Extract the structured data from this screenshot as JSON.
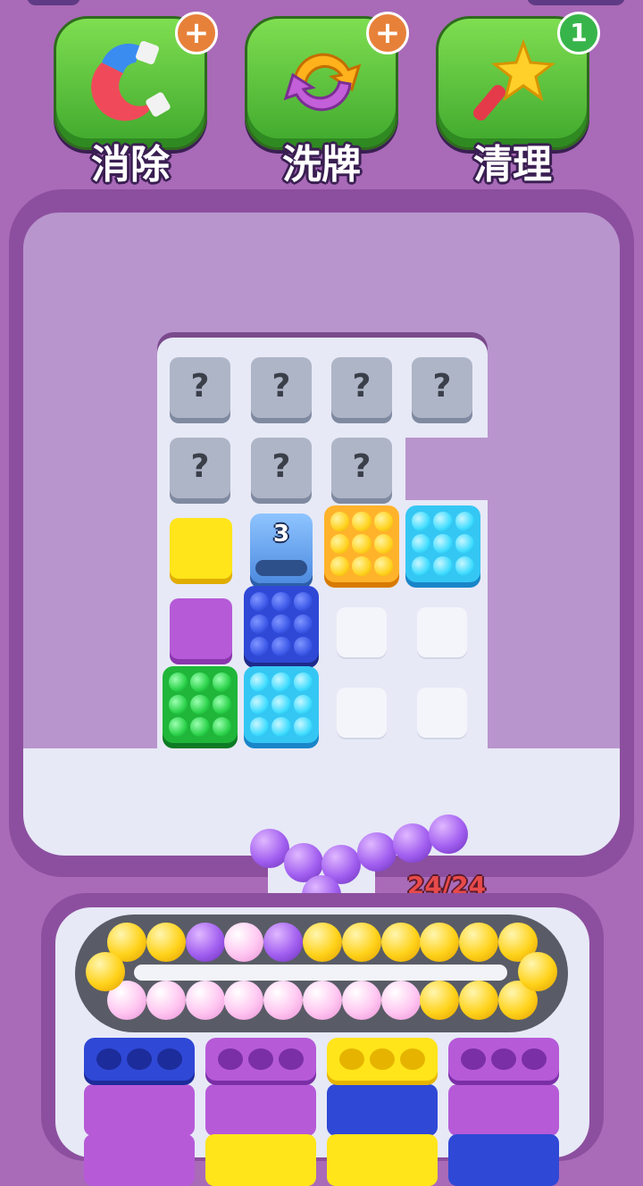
{
  "boosters": [
    {
      "label": "消除",
      "badge": "+",
      "icon": "magnet-icon"
    },
    {
      "label": "洗牌",
      "badge": "+",
      "icon": "shuffle-icon"
    },
    {
      "label": "清理",
      "badge": "1",
      "icon": "magic-wand-icon"
    }
  ],
  "board": {
    "unknown_symbol": "?",
    "counter_value": "3"
  },
  "capacity_text": "24/24",
  "colors": {
    "background": "#a96ab8",
    "board": "#b895cd",
    "floor": "#e7e9f6",
    "booster_green": "#4fbf36",
    "ball_purple": "#a25ff0",
    "ball_yellow": "#ffd21a",
    "ball_pink": "#ffc6f1"
  },
  "conveyor_balls": {
    "top_row": [
      "yellow",
      "yellow",
      "purple",
      "pink",
      "purple",
      "yellow",
      "yellow",
      "yellow",
      "yellow",
      "yellow",
      "yellow"
    ],
    "bottom_row": [
      "pink",
      "pink",
      "pink",
      "pink",
      "pink",
      "pink",
      "pink",
      "pink",
      "yellow",
      "yellow",
      "yellow"
    ],
    "left_end": "yellow",
    "right_end": "yellow"
  },
  "bins": [
    {
      "top": "blue",
      "layers": [
        "purple",
        "purple"
      ]
    },
    {
      "top": "purple",
      "layers": [
        "purple",
        "yellow"
      ]
    },
    {
      "top": "yellow",
      "layers": [
        "blue",
        "yellow"
      ]
    },
    {
      "top": "purple",
      "layers": [
        "purple",
        "blue"
      ]
    }
  ]
}
